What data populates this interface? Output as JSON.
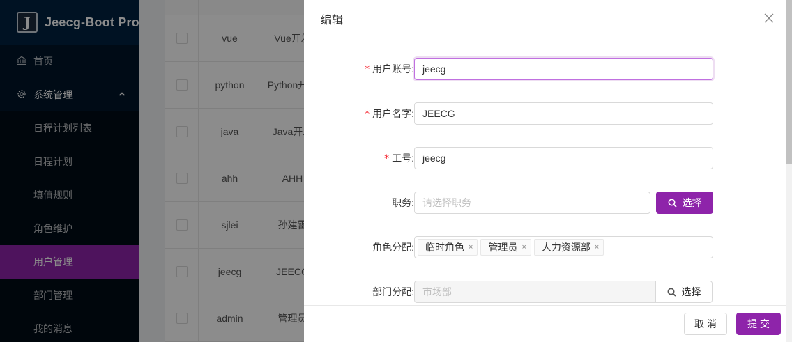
{
  "app": {
    "title": "Jeecg-Boot Pro",
    "logo_letter": "J"
  },
  "sidebar": {
    "home": "首页",
    "system": "系统管理",
    "sub_items": [
      {
        "label": "日程计划列表",
        "active": false
      },
      {
        "label": "日程计划",
        "active": false
      },
      {
        "label": "填值规则",
        "active": false
      },
      {
        "label": "角色维护",
        "active": false
      },
      {
        "label": "用户管理",
        "active": true
      },
      {
        "label": "部门管理",
        "active": false
      },
      {
        "label": "我的消息",
        "active": false
      }
    ]
  },
  "table": {
    "rows": [
      {
        "code": "vue",
        "name": "Vue开发"
      },
      {
        "code": "python",
        "name": "Python开发"
      },
      {
        "code": "java",
        "name": "Java开发"
      },
      {
        "code": "ahh",
        "name": "AHH"
      },
      {
        "code": "sjlei",
        "name": "孙建雷"
      },
      {
        "code": "jeecg",
        "name": "JEECG"
      },
      {
        "code": "admin",
        "name": "管理员"
      }
    ]
  },
  "drawer": {
    "title": "编辑",
    "close_icon": "close-icon",
    "fields": {
      "username": {
        "label": "用户账号:",
        "value": "jeecg",
        "required": "*"
      },
      "realname": {
        "label": "用户名字:",
        "value": "JEECG",
        "required": "*"
      },
      "workno": {
        "label": "工号:",
        "value": "jeecg",
        "required": "*"
      },
      "post": {
        "label": "职务:",
        "placeholder": "请选择职务",
        "button": "选择"
      },
      "roles": {
        "label": "角色分配:",
        "tags": [
          "临时角色",
          "管理员",
          "人力资源部"
        ],
        "tag_close": "×"
      },
      "depart": {
        "label": "部门分配:",
        "value": "市场部",
        "button": "选择"
      }
    },
    "footer": {
      "cancel": "取 消",
      "submit": "提 交"
    }
  },
  "colors": {
    "accent": "#8e24aa",
    "sidebar_bg": "#001529",
    "required": "#f5222d"
  }
}
